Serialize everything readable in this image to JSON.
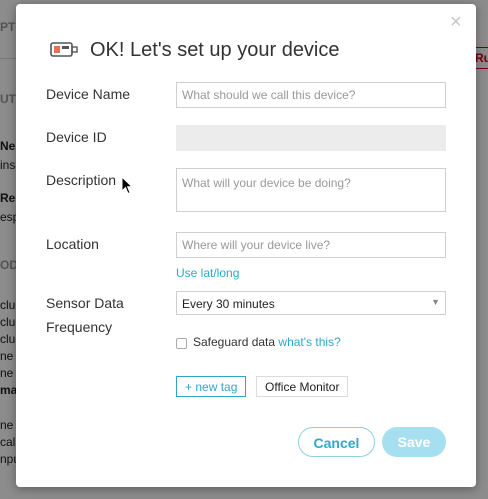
{
  "background": {
    "fragments": [
      "PTI",
      "UTI",
      "Ne",
      "ins",
      "Re",
      "esp",
      "ODI",
      "cluc",
      "cluc",
      "cluc",
      "ne",
      "ne li",
      "max",
      "ne m",
      "calls",
      "npu"
    ],
    "tag": "Ru"
  },
  "modal": {
    "close_glyph": "×",
    "title": "OK! Let's set up your device",
    "icon": "device-icon"
  },
  "form": {
    "device_name": {
      "label": "Device Name",
      "value": "",
      "placeholder": "What should we call this device?"
    },
    "device_id": {
      "label": "Device ID",
      "value": ""
    },
    "description": {
      "label": "Description",
      "value": "",
      "placeholder": "What will your device be doing?"
    },
    "location": {
      "label": "Location",
      "value": "",
      "placeholder": "Where will your device live?",
      "latlong_link": "Use lat/long"
    },
    "frequency": {
      "label_line1": "Sensor Data",
      "label_line2": "Frequency",
      "selected": "Every 30 minutes"
    },
    "safeguard": {
      "label": "Safeguard data",
      "link": "what's this?",
      "checked": false
    },
    "tags": {
      "new_tag": "+ new tag",
      "items": [
        "Office Monitor"
      ]
    }
  },
  "actions": {
    "cancel": "Cancel",
    "save": "Save"
  },
  "colors": {
    "accent": "#2ea7c9",
    "save_disabled": "#a6dff0"
  }
}
